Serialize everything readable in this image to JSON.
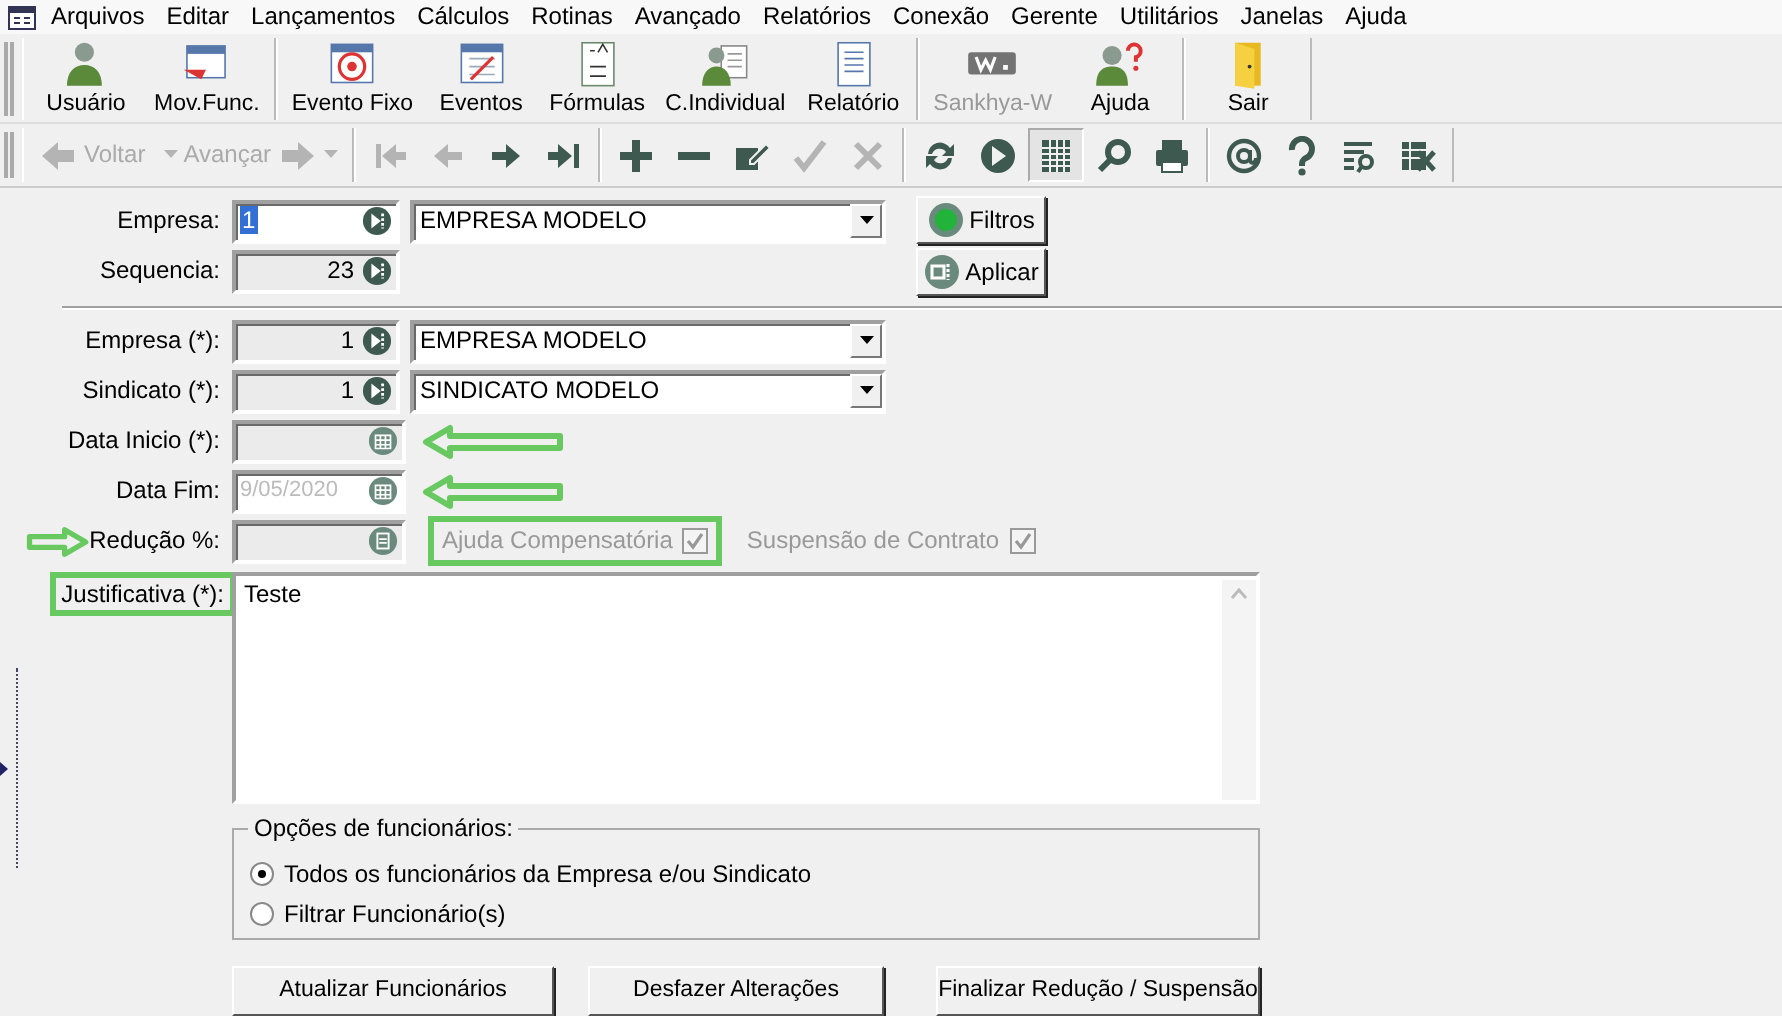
{
  "menu": [
    {
      "label": "Arquivos"
    },
    {
      "label": "Editar"
    },
    {
      "label": "Lançamentos"
    },
    {
      "label": "Cálculos"
    },
    {
      "label": "Rotinas"
    },
    {
      "label": "Avançado"
    },
    {
      "label": "Relatórios"
    },
    {
      "label": "Conexão"
    },
    {
      "label": "Gerente"
    },
    {
      "label": "Utilitários"
    },
    {
      "label": "Janelas"
    },
    {
      "label": "Ajuda"
    }
  ],
  "toolbar": [
    [
      {
        "label": "Usuário",
        "kind": "user",
        "disabled": false
      },
      {
        "label": "Mov.Func.",
        "kind": "calendar-user",
        "disabled": false
      }
    ],
    [
      {
        "label": "Evento Fixo",
        "kind": "target-calendar",
        "disabled": false
      },
      {
        "label": "Eventos",
        "kind": "calendar",
        "disabled": false
      },
      {
        "label": "Fórmulas",
        "kind": "formula",
        "disabled": false
      },
      {
        "label": "C.Individual",
        "kind": "user-card",
        "disabled": false
      },
      {
        "label": "Relatório",
        "kind": "document",
        "disabled": false
      }
    ],
    [
      {
        "label": "Sankhya-W",
        "kind": "w-logo",
        "disabled": true
      },
      {
        "label": "Ajuda",
        "kind": "user-help",
        "disabled": false
      }
    ],
    [
      {
        "label": "Sair",
        "kind": "door",
        "disabled": false
      }
    ]
  ],
  "nav_toolbar": [
    [
      {
        "kind": "back",
        "label": "Voltar",
        "disabled": true,
        "selected": false
      },
      {
        "kind": "forward",
        "label": "Avançar",
        "disabled": true,
        "selected": false
      }
    ],
    [
      {
        "kind": "first",
        "disabled": true,
        "selected": false
      },
      {
        "kind": "prev",
        "disabled": true,
        "selected": false
      },
      {
        "kind": "next",
        "disabled": false,
        "selected": false
      },
      {
        "kind": "last",
        "disabled": false,
        "selected": false
      }
    ],
    [
      {
        "kind": "add",
        "disabled": false,
        "selected": false
      },
      {
        "kind": "remove",
        "disabled": false,
        "selected": false
      },
      {
        "kind": "edit",
        "disabled": false,
        "selected": false
      },
      {
        "kind": "confirm",
        "disabled": true,
        "selected": false
      },
      {
        "kind": "cancel",
        "disabled": true,
        "selected": false
      }
    ],
    [
      {
        "kind": "refresh",
        "disabled": false,
        "selected": false
      },
      {
        "kind": "play",
        "disabled": false,
        "selected": false
      },
      {
        "kind": "grid",
        "disabled": false,
        "selected": true
      },
      {
        "kind": "search",
        "disabled": false,
        "selected": false
      },
      {
        "kind": "print",
        "disabled": false,
        "selected": false
      }
    ],
    [
      {
        "kind": "at",
        "disabled": false,
        "selected": false
      },
      {
        "kind": "help",
        "disabled": false,
        "selected": false
      },
      {
        "kind": "find-list",
        "disabled": false,
        "selected": false
      },
      {
        "kind": "clear-grid",
        "disabled": false,
        "selected": false
      }
    ]
  ],
  "header": {
    "fields": [
      {
        "label": "Empresa:",
        "value": "1",
        "editable": true,
        "description": "EMPRESA MODELO"
      },
      {
        "label": "Sequencia:",
        "value": "23",
        "editable": false
      }
    ],
    "buttons": [
      {
        "label": "Filtros",
        "kind": "filter"
      },
      {
        "label": "Aplicar",
        "kind": "apply"
      }
    ]
  },
  "fields": [
    {
      "label": "Empresa (*):",
      "kind": "lookup",
      "value": "1",
      "description": "EMPRESA MODELO"
    },
    {
      "label": "Sindicato (*):",
      "kind": "lookup",
      "value": "1",
      "description": "SINDICATO MODELO"
    },
    {
      "label": "Data Inicio (*):",
      "kind": "date",
      "disabled": true
    },
    {
      "label": "Data Fim:",
      "kind": "date",
      "value": "9/05/2020",
      "disabled": false
    },
    {
      "label": "Redução %:",
      "kind": "calc",
      "disabled": true
    }
  ],
  "checkboxes": [
    {
      "label": "Ajuda Compensatória",
      "checked": true,
      "disabled": true
    },
    {
      "label": "Suspensão de Contrato",
      "checked": true,
      "disabled": true
    }
  ],
  "justification": {
    "label": "Justificativa (*):",
    "value": "Teste"
  },
  "employee_options": {
    "title": "Opções de funcionários:",
    "options": [
      {
        "label": "Todos os funcionários da Empresa e/ou Sindicato",
        "selected": true
      },
      {
        "label": "Filtrar Funcionário(s)",
        "selected": false
      }
    ]
  },
  "actions": [
    {
      "label": "Atualizar Funcionários"
    },
    {
      "label": "Desfazer Alterações"
    },
    {
      "label": "Finalizar Redução / Suspensão"
    }
  ]
}
